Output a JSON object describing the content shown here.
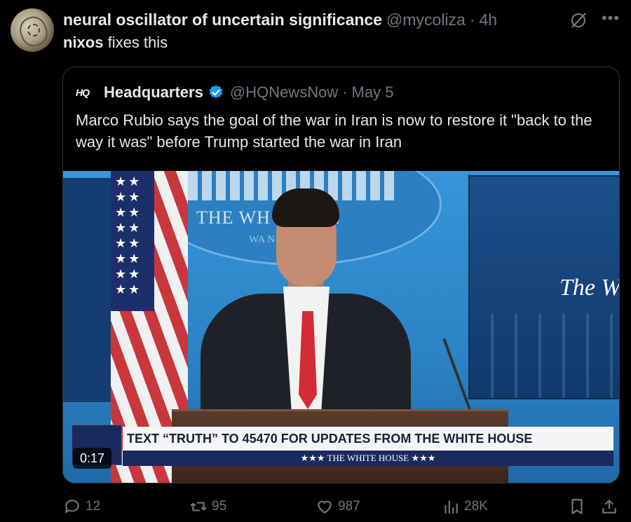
{
  "post": {
    "author_name": "neural oscillator of uncertain significance",
    "handle": "@mycoliza",
    "separator": "·",
    "time": "4h",
    "text_mention": "nixos",
    "text_rest": " fixes this"
  },
  "quote": {
    "logo": "HQ",
    "name": "Headquarters",
    "handle": "@HQNewsNow",
    "separator": "·",
    "date": "May 5",
    "text": "Marco Rubio says the goal of the war in Iran is now to restore it \"back to the way it was\" before Trump started the war in Iran",
    "video": {
      "backdrop_seal_text": "THE WH  HOUSE",
      "backdrop_seal_sub": "WA      N",
      "screen_text": "The W",
      "lower_third_main": "TEXT “TRUTH” TO 45470 FOR UPDATES FROM THE WHITE HOUSE",
      "lower_third_sub": "★★★  THE WHITE HOUSE  ★★★",
      "duration": "0:17"
    }
  },
  "actions": {
    "replies": "12",
    "reposts": "95",
    "likes": "987",
    "views": "28K"
  },
  "icons": {
    "more": "more-icon",
    "grok": "grok-icon",
    "verified": "verified-icon",
    "reply": "reply-icon",
    "repost": "repost-icon",
    "like": "like-icon",
    "views": "views-icon",
    "bookmark": "bookmark-icon",
    "share": "share-icon"
  },
  "colors": {
    "background": "#000000",
    "text": "#e7e9ea",
    "muted": "#71767b",
    "verified": "#1d9bf0",
    "border": "#2f3336"
  }
}
